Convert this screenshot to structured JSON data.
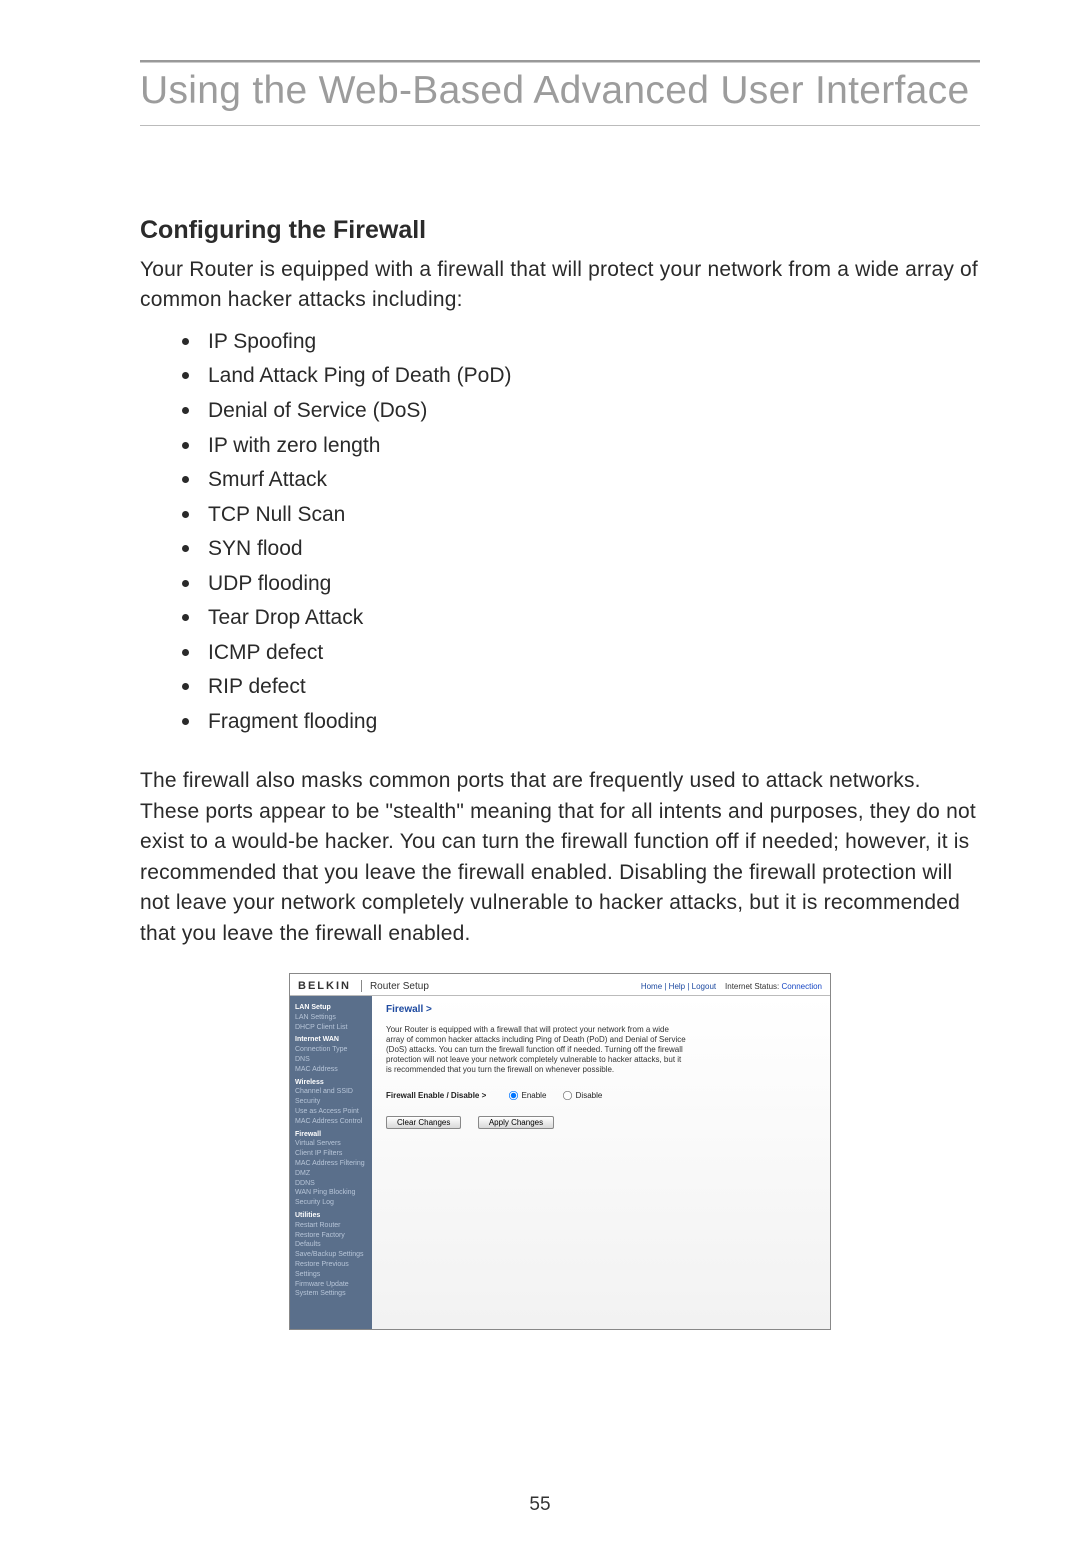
{
  "header": {
    "title": "Using the Web-Based Advanced User Interface"
  },
  "section": {
    "title": "Configuring the Firewall",
    "intro": "Your Router is equipped with a firewall that will protect your network from a wide array of common hacker attacks including:",
    "attacks": [
      "IP Spoofing",
      "Land Attack Ping of Death (PoD)",
      "Denial of Service (DoS)",
      "IP with zero length",
      "Smurf Attack",
      "TCP Null Scan",
      "SYN flood",
      "UDP flooding",
      "Tear Drop Attack",
      "ICMP defect",
      "RIP defect",
      "Fragment flooding"
    ],
    "explain": "The firewall also masks common ports that are frequently used to attack networks. These ports appear to be \"stealth\" meaning that for all intents and purposes, they do not exist to a would-be hacker. You can turn the firewall function off if needed; however, it is recommended that you leave the firewall enabled. Disabling the firewall protection will not leave your network completely vulnerable to hacker attacks, but it is recommended that you leave the firewall enabled."
  },
  "screenshot": {
    "brand": "BELKIN",
    "headerLabel": "Router Setup",
    "topLinks": {
      "left": "Home | Help | Logout",
      "statusLabel": "Internet Status:",
      "statusValue": "Connection"
    },
    "sidebar": {
      "groups": [
        {
          "title": "LAN Setup",
          "items": [
            "LAN Settings",
            "DHCP Client List"
          ]
        },
        {
          "title": "Internet WAN",
          "items": [
            "Connection Type",
            "DNS",
            "MAC Address"
          ]
        },
        {
          "title": "Wireless",
          "items": [
            "Channel and SSID",
            "Security",
            "Use as Access Point",
            "MAC Address Control"
          ]
        },
        {
          "title": "Firewall",
          "active": true,
          "items": [
            "Virtual Servers",
            "Client IP Filters",
            "MAC Address Filtering",
            "DMZ",
            "DDNS",
            "WAN Ping Blocking",
            "Security Log"
          ]
        },
        {
          "title": "Utilities",
          "items": [
            "Restart Router",
            "Restore Factory Defaults",
            "Save/Backup Settings",
            "Restore Previous Settings",
            "Firmware Update",
            "System Settings"
          ]
        }
      ]
    },
    "main": {
      "crumb": "Firewall >",
      "desc": "Your Router is equipped with a firewall that will protect your network from a wide array of common hacker attacks including Ping of Death (PoD) and Denial of Service (DoS) attacks. You can turn the firewall function off if needed. Turning off the firewall protection will not leave your network completely vulnerable to hacker attacks, but it is recommended that you turn the firewall on whenever possible.",
      "optionLabel": "Firewall Enable / Disable >",
      "enable": "Enable",
      "disable": "Disable",
      "clear": "Clear Changes",
      "apply": "Apply Changes"
    }
  },
  "pageNumber": "55"
}
